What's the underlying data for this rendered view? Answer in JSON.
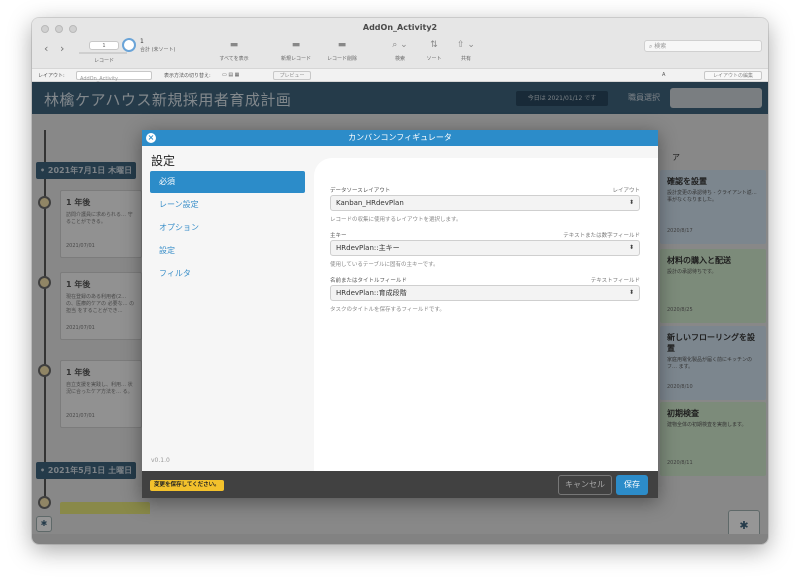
{
  "window": {
    "title": "AddOn_Activity2"
  },
  "toolbar": {
    "record_field": "1",
    "total_count": "1",
    "total_label": "合計 (未ソート)",
    "records_label": "レコード",
    "show_all": "すべてを表示",
    "new_record": "新規レコード",
    "delete_record": "レコード削除",
    "find": "検索",
    "sort": "ソート",
    "share": "共有",
    "search_placeholder": "検索"
  },
  "layoutbar": {
    "layout_label": "レイアウト:",
    "layout_value": "AddOn_Activity",
    "view_as": "表示方法の切り替え:",
    "preview": "プレビュー",
    "font_icon": "A",
    "edit_layout": "レイアウトの編集"
  },
  "header": {
    "title": "林檎ケアハウス新規採用者育成計画",
    "today": "今日は 2021/01/12 です",
    "staff_label": "職員選択"
  },
  "timeline": {
    "date1": "2021年7月1日 木曜日",
    "date2": "2021年5月1日 土曜日",
    "cards": [
      {
        "title": "1 年後",
        "desc": "訪問介護員に求められる… 守ることができる。",
        "date": "2021/07/01"
      },
      {
        "title": "1 年後",
        "desc": "現在登録のある利用者(2… の、医療的ケアの 必要な… の担当 をすることができ…",
        "date": "2021/07/01"
      },
      {
        "title": "1 年後",
        "desc": "自立支援を実践し、利用… 状況に合ったケア方法を… る。",
        "date": "2021/07/01"
      }
    ]
  },
  "right_column": {
    "header_fragment": "ア",
    "cards": [
      {
        "title": "確認を設置",
        "desc": "設計変更の承認待ち - クライアント返… 事がなくなりました。",
        "date": "2020/8/17",
        "color": "#c9d9e6"
      },
      {
        "title": "材料の購入と配送",
        "desc": "設計の承認待ちです。",
        "date": "2020/8/25",
        "color": "#c9e0c5"
      },
      {
        "title": "新しいフローリングを設置",
        "desc": "家庭用電化製品が届く前にキッチンのフ… ます。",
        "date": "2020/8/10",
        "color": "#c9d9e6"
      },
      {
        "title": "初期検査",
        "desc": "建物全体の初期検査を実施します。",
        "date": "2020/8/11",
        "color": "#c9e0c5"
      }
    ]
  },
  "modal": {
    "title": "カンバンコンフィギュレータ",
    "close": "×",
    "side_title": "設定",
    "nav": [
      "必須",
      "レーン設定",
      "オプション",
      "設定",
      "フィルタ"
    ],
    "version": "v0.1.0",
    "fields": [
      {
        "label": "データソースレイアウト",
        "right": "レイアウト",
        "value": "Kanban_HRdevPlan",
        "help": "レコードの収集に使用するレイアウトを選択します。"
      },
      {
        "label": "主キー",
        "right": "テキストまたは数字フィールド",
        "value": "HRdevPlan::主キー",
        "help": "使用しているテーブルに固有の主キーです。"
      },
      {
        "label": "名前またはタイトルフィールド",
        "right": "テキストフィールド",
        "value": "HRdevPlan::育成段階",
        "help": "タスクのタイトルを保存するフィールドです。"
      }
    ],
    "warning": "変更を保存してください。",
    "cancel": "キャンセル",
    "save": "保存"
  },
  "colors": {
    "accent": "#2c8cc9",
    "header": "#3c5f78",
    "warning": "#f3c12c"
  }
}
